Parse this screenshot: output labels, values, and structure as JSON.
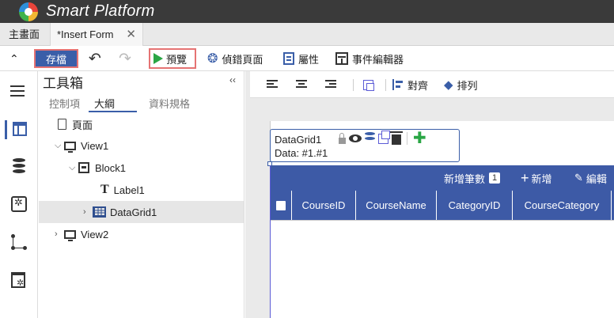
{
  "app": {
    "title": "Smart Platform"
  },
  "tabs": [
    {
      "label": "主畫面"
    },
    {
      "label": "*Insert Form",
      "close": "✕"
    }
  ],
  "toolbar": {
    "save_label": "存檔",
    "preview_label": "預覽",
    "debug_label": "偵錯頁面",
    "properties_label": "屬性",
    "events_label": "事件編輯器"
  },
  "toolbox": {
    "title": "工具箱",
    "subtabs": [
      "控制項",
      "大綱",
      "資料規格"
    ],
    "active_subtab": "大綱",
    "tree": [
      {
        "label": "頁面",
        "level": 0
      },
      {
        "label": "View1",
        "level": 1,
        "expanded": true
      },
      {
        "label": "Block1",
        "level": 2,
        "expanded": true
      },
      {
        "label": "Label1",
        "level": 3
      },
      {
        "label": "DataGrid1",
        "level": 3,
        "selected": true
      },
      {
        "label": "View2",
        "level": 1,
        "expanded": false
      }
    ]
  },
  "designer_toolbar": {
    "align_label": "對齊",
    "arrange_label": "排列"
  },
  "datagrid": {
    "name": "DataGrid1",
    "data": "Data: #1.#1",
    "header": {
      "add_count_label": "新增筆數",
      "add_count_value": "1",
      "add_label": "新增",
      "edit_label": "編輯"
    },
    "columns": [
      "CourseID",
      "CourseName",
      "CategoryID",
      "CourseCategory"
    ]
  },
  "colors": {
    "titlebar": "#3a3a3a",
    "accent": "#3a5ea8",
    "grid_header": "#3d5aa6",
    "highlight_border": "#e57373",
    "play": "#2aa645"
  }
}
